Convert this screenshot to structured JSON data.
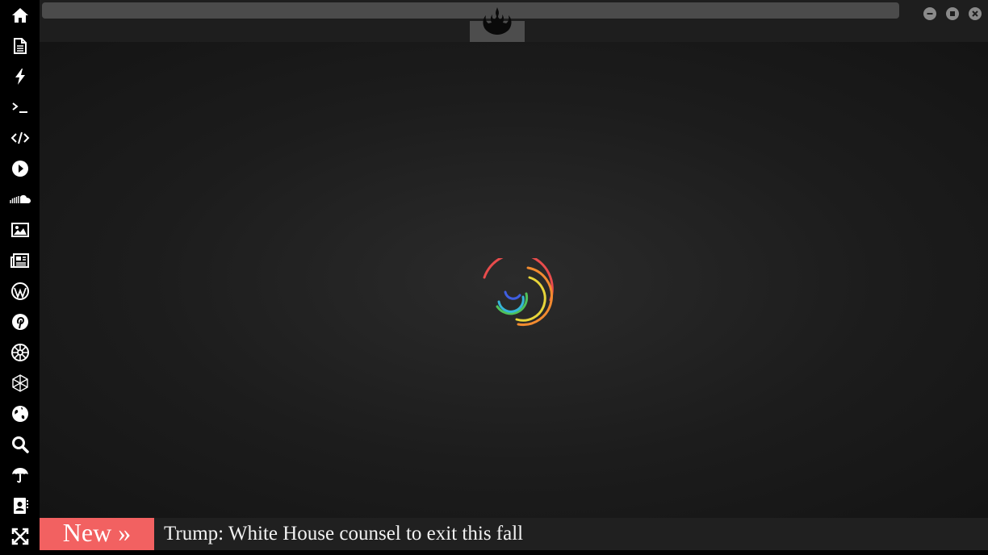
{
  "sidebar": {
    "items": [
      {
        "icon": "home-icon"
      },
      {
        "icon": "document-icon"
      },
      {
        "icon": "lightning-icon"
      },
      {
        "icon": "terminal-icon"
      },
      {
        "icon": "code-icon"
      },
      {
        "icon": "play-icon"
      },
      {
        "icon": "soundcloud-icon"
      },
      {
        "icon": "image-icon"
      },
      {
        "icon": "newspaper-icon"
      },
      {
        "icon": "wordpress-icon"
      },
      {
        "icon": "pinterest-icon"
      },
      {
        "icon": "galactic-empire-icon"
      },
      {
        "icon": "hexagon-network-icon"
      },
      {
        "icon": "globe-icon"
      },
      {
        "icon": "search-icon"
      },
      {
        "icon": "umbrella-icon"
      },
      {
        "icon": "contacts-icon"
      },
      {
        "icon": "fullscreen-icon"
      }
    ]
  },
  "topbar": {
    "logo_icon": "rebel-alliance-icon",
    "window_controls": [
      "minimize-icon",
      "maximize-icon",
      "close-icon"
    ]
  },
  "main": {
    "loading_spinner": "rainbow-spinner"
  },
  "ticker": {
    "badge_label": "New »",
    "headline": "Trump: White House counsel to exit this fall"
  },
  "colors": {
    "ticker_badge": "#f26161",
    "sidebar_bg": "#000000",
    "main_bg": "#1e1e1e"
  }
}
